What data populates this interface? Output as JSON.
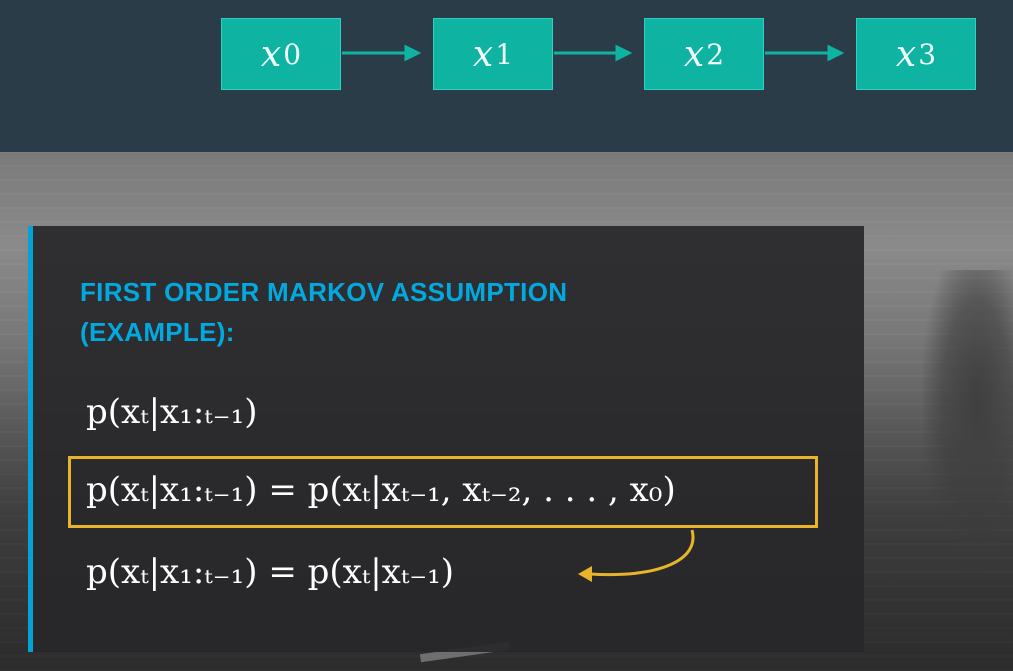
{
  "diagram": {
    "nodes": [
      {
        "var": "x",
        "sub": "0"
      },
      {
        "var": "x",
        "sub": "1"
      },
      {
        "var": "x",
        "sub": "2"
      },
      {
        "var": "x",
        "sub": "3"
      }
    ],
    "node_color": "#0fb3a2",
    "arrow_color": "#0fb3a2"
  },
  "panel": {
    "heading_line1": "FIRST ORDER MARKOV ASSUMPTION",
    "heading_line2": "(EXAMPLE):",
    "heading_color": "#02a8e0",
    "accent_color": "#02a3d6",
    "highlight_color": "#e8b52a"
  },
  "equations": {
    "eq1": "p(xₜ|x₁:ₜ₋₁)",
    "eq2": "p(xₜ|x₁:ₜ₋₁) = p(xₜ|xₜ₋₁, xₜ₋₂, . . . , x₀)",
    "eq3": "p(xₜ|x₁:ₜ₋₁) = p(xₜ|xₜ₋₁)"
  }
}
